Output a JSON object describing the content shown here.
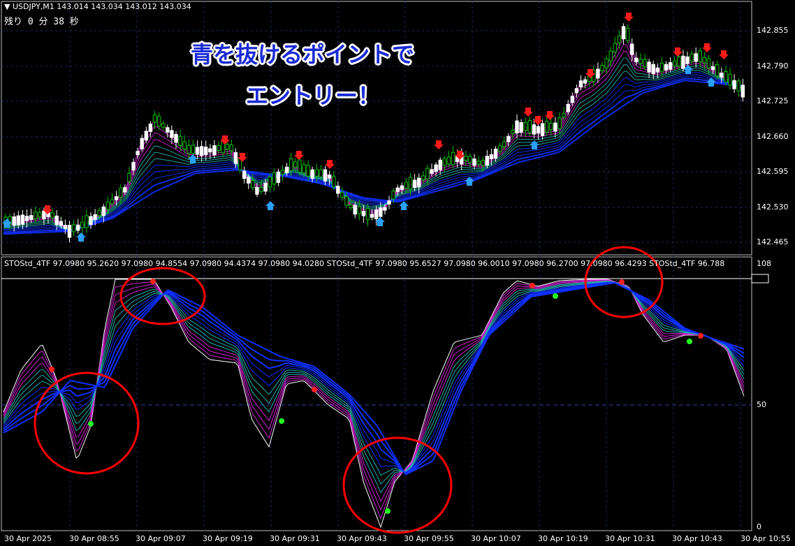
{
  "header": {
    "symbol": "▼ USDJPY,M1  143.014 143.034 143.012 143.034",
    "remaining": "残り 0 分 38 秒"
  },
  "banner": {
    "line1": "青を抜けるポイントで",
    "line2": "エントリー！",
    "color": "#1a2bd6"
  },
  "price_axis": {
    "ticks": [
      "142.855",
      "142.790",
      "142.725",
      "142.660",
      "142.595",
      "142.530",
      "142.465"
    ]
  },
  "indicator": {
    "header": "STOStd_4TF 97.0980 95.2620 97.0980 94.8554 97.0980 94.4374 97.0980 94.0280  STOStd_4TF 97.0980 95.6527 97.0980 96.0010 97.0980 96.2700 97.0980 96.4293  STOStd_4TF 96.788",
    "axis_ticks": [
      "108",
      "100",
      "50",
      "0"
    ]
  },
  "time_axis": {
    "ticks": [
      "30 Apr 2025",
      "30 Apr 08:55",
      "30 Apr 09:07",
      "30 Apr 09:19",
      "30 Apr 09:31",
      "30 Apr 09:43",
      "30 Apr 09:55",
      "30 Apr 10:07",
      "30 Apr 10:19",
      "30 Apr 10:31",
      "30 Apr 10:43",
      "30 Apr 10:55"
    ]
  },
  "colors": {
    "bull": "#00c000",
    "bear": "#ffffff",
    "fast_ribbon": "#d020d0",
    "mid_ribbon": "#20b0b0",
    "slow_ribbon": "#1030ff",
    "sell_arrow": "#ff1a1a",
    "buy_arrow": "#2aa0ff",
    "circle": "#ff0000"
  },
  "icons": [
    "sell-arrow-icon",
    "buy-arrow-icon",
    "highlight-circle"
  ]
}
